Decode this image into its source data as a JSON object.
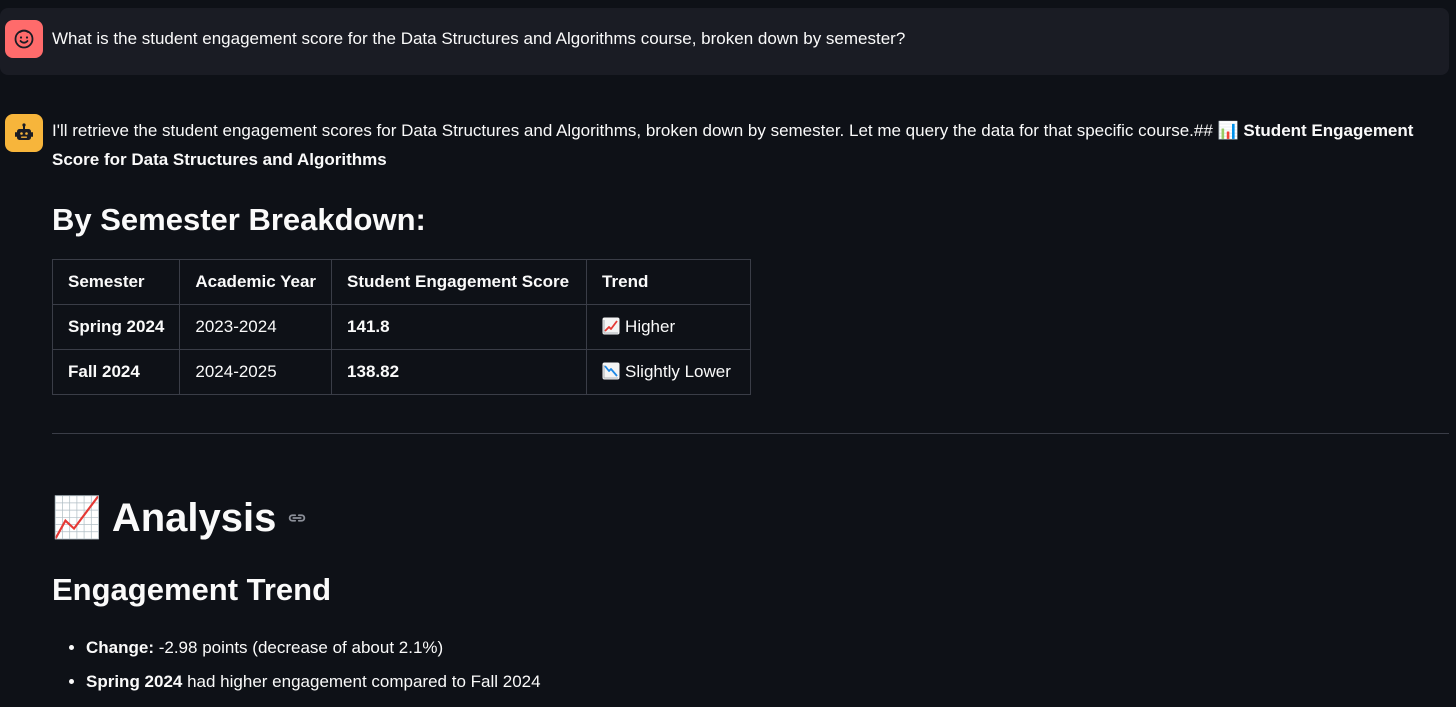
{
  "user_message": {
    "avatar_icon": "smiley-face-icon",
    "text": "What is the student engagement score for the Data Structures and Algorithms course, broken down by semester?"
  },
  "assistant_message": {
    "avatar_icon": "robot-icon",
    "intro_text": "I'll retrieve the student engagement scores for Data Structures and Algorithms, broken down by semester. Let me query the data for that specific course.## ",
    "intro_emoji": "📊",
    "intro_bold": " Student Engagement Score for Data Structures and Algorithms",
    "breakdown_heading": "By Semester Breakdown:",
    "table": {
      "headers": [
        "Semester",
        "Academic Year",
        "Student Engagement Score",
        "Trend"
      ],
      "rows": [
        {
          "semester": "Spring 2024",
          "year": "2023-2024",
          "score": "141.8",
          "trend_icon": "chart-increasing-icon",
          "trend": "Higher"
        },
        {
          "semester": "Fall 2024",
          "year": "2024-2025",
          "score": "138.82",
          "trend_icon": "chart-decreasing-icon",
          "trend": "Slightly Lower"
        }
      ]
    },
    "analysis_emoji": "📈",
    "analysis_heading": "Analysis",
    "trend_heading": "Engagement Trend",
    "bullets": [
      {
        "bold": "Change:",
        "text": " -2.98 points (decrease of about 2.1%)"
      },
      {
        "bold": "Spring 2024",
        "text": " had higher engagement compared to Fall 2024"
      }
    ]
  },
  "colors": {
    "background": "#0e1117",
    "user_bubble": "#1a1c24",
    "user_avatar": "#ff6b6b",
    "bot_avatar": "#f7b53b",
    "border": "#3a3d47"
  }
}
